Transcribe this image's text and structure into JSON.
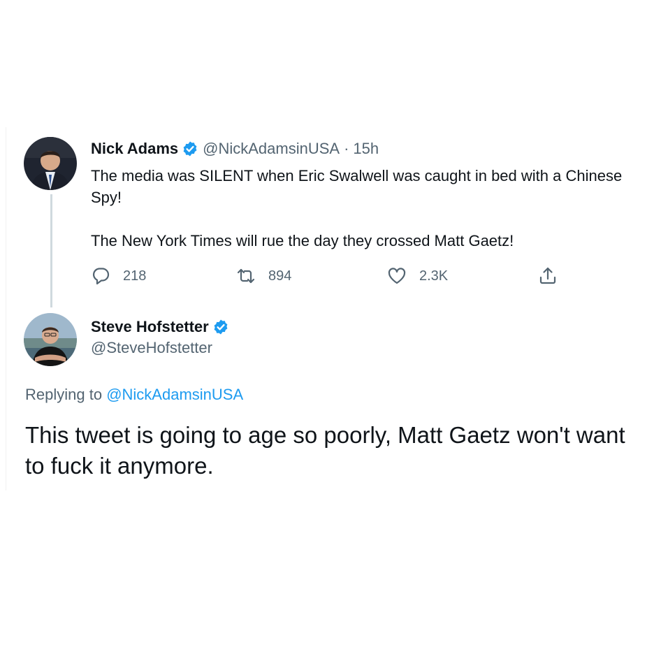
{
  "tweet": {
    "author_name": "Nick Adams",
    "author_handle": "@NickAdamsinUSA",
    "separator": "·",
    "time": "15h",
    "text_lines": [
      "The media was SILENT when Eric Swalwell was caught in bed with a Chinese Spy!",
      "The New York Times will rue the day they crossed Matt Gaetz!"
    ],
    "actions": {
      "reply_count": "218",
      "retweet_count": "894",
      "like_count": "2.3K"
    }
  },
  "reply": {
    "author_name": "Steve Hofstetter",
    "author_handle": "@SteveHofstetter",
    "replying_prefix": "Replying to",
    "replying_to": "@NickAdamsinUSA",
    "text": "This tweet is going to age so poorly, Matt Gaetz won't want to fuck it anymore."
  },
  "icons": {
    "verified": "verified-badge-icon",
    "reply": "reply-bubble-icon",
    "retweet": "retweet-icon",
    "like": "heart-icon",
    "share": "share-icon"
  },
  "colors": {
    "verified": "#1d9bf0",
    "mention": "#1d9bf0",
    "secondary_text": "#536471",
    "thread_line": "#cfd9de"
  }
}
